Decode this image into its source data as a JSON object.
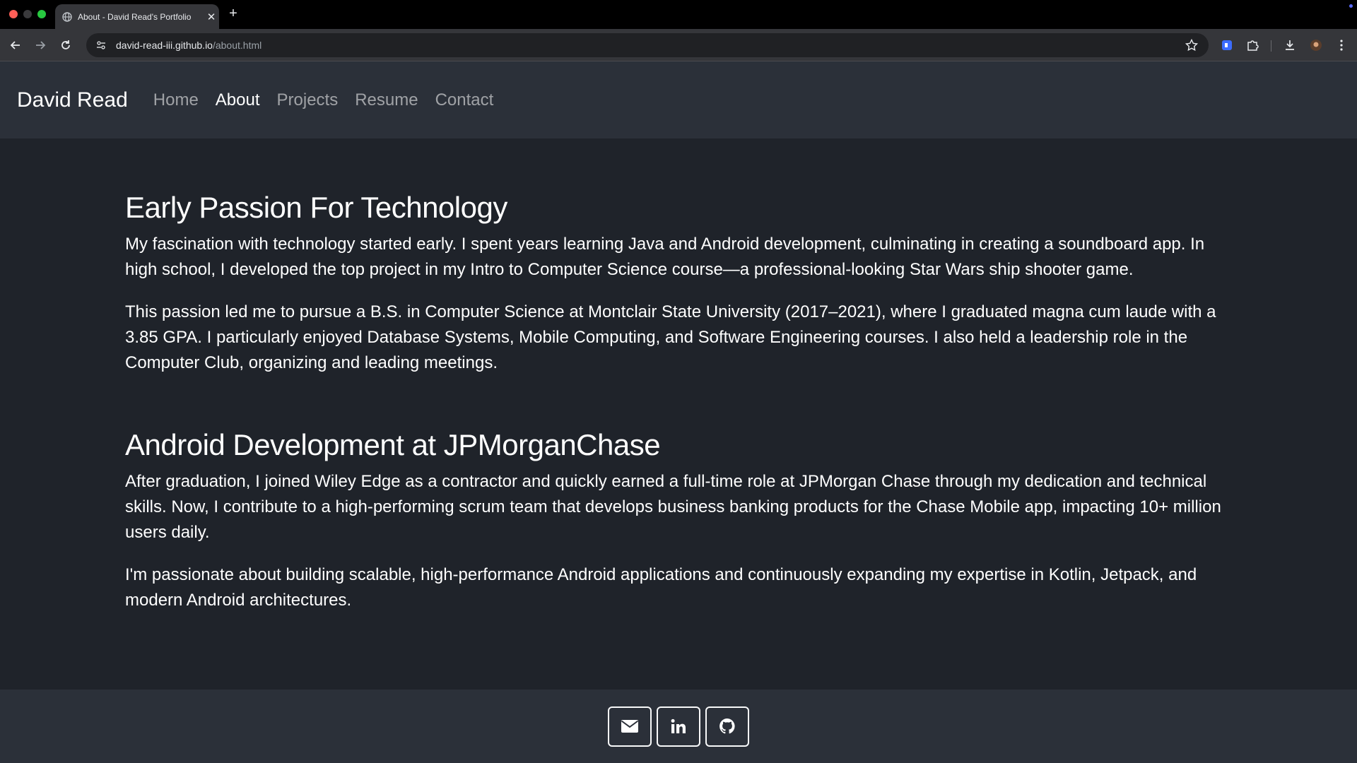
{
  "browser": {
    "tab_title": "About - David Read's Portfolio",
    "url_host": "david-read-iii.github.io",
    "url_path": "/about.html",
    "new_tab_glyph": "+",
    "close_glyph": "✕"
  },
  "site": {
    "brand": "David Read",
    "nav": [
      {
        "label": "Home",
        "active": false
      },
      {
        "label": "About",
        "active": true
      },
      {
        "label": "Projects",
        "active": false
      },
      {
        "label": "Resume",
        "active": false
      },
      {
        "label": "Contact",
        "active": false
      }
    ]
  },
  "sections": [
    {
      "heading": "Early Passion For Technology",
      "paragraphs": [
        "My fascination with technology started early. I spent years learning Java and Android development, culminating in creating a soundboard app. In high school, I developed the top project in my Intro to Computer Science course—a professional-looking Star Wars ship shooter game.",
        "This passion led me to pursue a B.S. in Computer Science at Montclair State University (2017–2021), where I graduated magna cum laude with a 3.85 GPA. I particularly enjoyed Database Systems, Mobile Computing, and Software Engineering courses. I also held a leadership role in the Computer Club, organizing and leading meetings."
      ]
    },
    {
      "heading": "Android Development at JPMorganChase",
      "paragraphs": [
        "After graduation, I joined Wiley Edge as a contractor and quickly earned a full-time role at JPMorgan Chase through my dedication and technical skills. Now, I contribute to a high-performing scrum team that develops business banking products for the Chase Mobile app, impacting 10+ million users daily.",
        "I'm passionate about building scalable, high-performance Android applications and continuously expanding my expertise in Kotlin, Jetpack, and modern Android architectures."
      ]
    }
  ],
  "footer": {
    "links": [
      {
        "icon": "envelope-icon"
      },
      {
        "icon": "linkedin-icon"
      },
      {
        "icon": "github-icon"
      }
    ]
  },
  "colors": {
    "page_bg": "#1f232a",
    "navbar_bg": "#2b3039",
    "text": "#ffffff",
    "nav_muted": "rgba(255,255,255,0.55)"
  }
}
